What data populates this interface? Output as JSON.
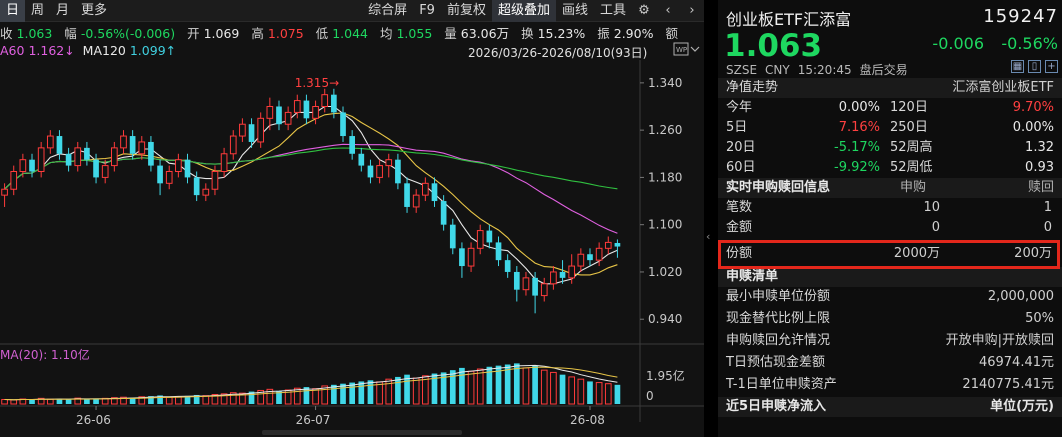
{
  "toolbar": {
    "left_tabs": [
      "日",
      "周",
      "月",
      "更多"
    ],
    "right_buttons": [
      "综合屏",
      "F9",
      "前复权",
      "超级叠加",
      "画线",
      "工具"
    ],
    "icons": [
      "gear-icon",
      "chevron-left-icon",
      "chevron-right-icon"
    ]
  },
  "info": {
    "close_label": "收",
    "close_value": "1.063",
    "change_label": "幅",
    "change_value": "-0.56%(-0.006)",
    "open_label": "开",
    "open_value": "1.069",
    "high_label": "高",
    "high_value": "1.075",
    "low_label": "低",
    "low_value": "1.044",
    "avg_label": "均",
    "avg_value": "1.055",
    "vol_label": "量",
    "vol_value": "63.06万",
    "turnover_label": "换",
    "turnover_value": "15.23%",
    "amp_label": "振",
    "amp_value": "2.90%",
    "amount_label": "额",
    "ma60_label": "A60",
    "ma60_value": "1.162↓",
    "ma120_label": "MA120",
    "ma120_value": "1.099↑",
    "date_range": "2026/03/26-2026/08/10(93日)"
  },
  "volume": {
    "label": "MA(20): 1.10亿",
    "axis_top": "1.95亿",
    "axis_zero": "0"
  },
  "chart_data": {
    "type": "candlestick",
    "y_ticks": [
      "1.340",
      "1.260",
      "1.180",
      "1.100",
      "1.020",
      "0.940"
    ],
    "ylim": [
      0.915,
      1.355
    ],
    "x_ticks": [
      "26-06",
      "26-07",
      "26-08"
    ],
    "annotation": "1.315→",
    "candles": [
      [
        1.15,
        1.16,
        1.13,
        1.17
      ],
      [
        1.16,
        1.19,
        1.15,
        1.2
      ],
      [
        1.19,
        1.21,
        1.18,
        1.22
      ],
      [
        1.21,
        1.19,
        1.18,
        1.22
      ],
      [
        1.19,
        1.23,
        1.18,
        1.24
      ],
      [
        1.23,
        1.25,
        1.22,
        1.26
      ],
      [
        1.25,
        1.22,
        1.21,
        1.26
      ],
      [
        1.22,
        1.2,
        1.19,
        1.23
      ],
      [
        1.2,
        1.23,
        1.19,
        1.24
      ],
      [
        1.23,
        1.21,
        1.2,
        1.24
      ],
      [
        1.21,
        1.18,
        1.17,
        1.22
      ],
      [
        1.18,
        1.2,
        1.17,
        1.21
      ],
      [
        1.2,
        1.23,
        1.19,
        1.24
      ],
      [
        1.23,
        1.25,
        1.22,
        1.26
      ],
      [
        1.25,
        1.22,
        1.21,
        1.26
      ],
      [
        1.22,
        1.24,
        1.21,
        1.25
      ],
      [
        1.24,
        1.2,
        1.19,
        1.25
      ],
      [
        1.2,
        1.17,
        1.15,
        1.21
      ],
      [
        1.17,
        1.19,
        1.16,
        1.2
      ],
      [
        1.19,
        1.21,
        1.18,
        1.22
      ],
      [
        1.21,
        1.18,
        1.17,
        1.22
      ],
      [
        1.18,
        1.15,
        1.14,
        1.19
      ],
      [
        1.15,
        1.16,
        1.14,
        1.17
      ],
      [
        1.16,
        1.19,
        1.15,
        1.2
      ],
      [
        1.19,
        1.22,
        1.18,
        1.23
      ],
      [
        1.22,
        1.25,
        1.21,
        1.26
      ],
      [
        1.25,
        1.27,
        1.24,
        1.28
      ],
      [
        1.27,
        1.24,
        1.23,
        1.28
      ],
      [
        1.24,
        1.28,
        1.23,
        1.29
      ],
      [
        1.28,
        1.3,
        1.26,
        1.315
      ],
      [
        1.3,
        1.27,
        1.26,
        1.31
      ],
      [
        1.27,
        1.29,
        1.26,
        1.3
      ],
      [
        1.29,
        1.31,
        1.28,
        1.32
      ],
      [
        1.31,
        1.28,
        1.27,
        1.32
      ],
      [
        1.28,
        1.3,
        1.27,
        1.31
      ],
      [
        1.3,
        1.32,
        1.29,
        1.33
      ],
      [
        1.32,
        1.29,
        1.28,
        1.33
      ],
      [
        1.29,
        1.25,
        1.24,
        1.3
      ],
      [
        1.25,
        1.22,
        1.21,
        1.26
      ],
      [
        1.22,
        1.2,
        1.19,
        1.23
      ],
      [
        1.2,
        1.18,
        1.17,
        1.21
      ],
      [
        1.18,
        1.2,
        1.17,
        1.21
      ],
      [
        1.2,
        1.21,
        1.18,
        1.22
      ],
      [
        1.21,
        1.17,
        1.16,
        1.22
      ],
      [
        1.17,
        1.13,
        1.12,
        1.18
      ],
      [
        1.13,
        1.15,
        1.12,
        1.16
      ],
      [
        1.15,
        1.17,
        1.14,
        1.18
      ],
      [
        1.17,
        1.14,
        1.13,
        1.18
      ],
      [
        1.14,
        1.1,
        1.09,
        1.15
      ],
      [
        1.1,
        1.06,
        1.05,
        1.11
      ],
      [
        1.06,
        1.03,
        1.01,
        1.07
      ],
      [
        1.03,
        1.06,
        1.02,
        1.07
      ],
      [
        1.06,
        1.09,
        1.05,
        1.1
      ],
      [
        1.09,
        1.07,
        1.06,
        1.1
      ],
      [
        1.07,
        1.04,
        1.03,
        1.08
      ],
      [
        1.04,
        1.02,
        1.01,
        1.05
      ],
      [
        1.02,
        0.99,
        0.97,
        1.03
      ],
      [
        0.99,
        1.01,
        0.98,
        1.02
      ],
      [
        1.01,
        0.98,
        0.95,
        1.02
      ],
      [
        0.98,
        1.0,
        0.97,
        1.01
      ],
      [
        1.0,
        1.02,
        0.99,
        1.03
      ],
      [
        1.02,
        1.01,
        1.0,
        1.04
      ],
      [
        1.01,
        1.03,
        1.0,
        1.05
      ],
      [
        1.03,
        1.05,
        1.02,
        1.06
      ],
      [
        1.05,
        1.04,
        1.03,
        1.06
      ],
      [
        1.04,
        1.06,
        1.03,
        1.07
      ],
      [
        1.06,
        1.07,
        1.05,
        1.08
      ],
      [
        1.069,
        1.063,
        1.044,
        1.075
      ]
    ],
    "volumes": [
      0.2,
      0.18,
      0.22,
      0.19,
      0.25,
      0.21,
      0.23,
      0.2,
      0.26,
      0.24,
      0.22,
      0.25,
      0.28,
      0.3,
      0.27,
      0.32,
      0.35,
      0.38,
      0.3,
      0.33,
      0.36,
      0.4,
      0.37,
      0.42,
      0.45,
      0.5,
      0.48,
      0.55,
      0.6,
      0.65,
      0.58,
      0.62,
      0.7,
      0.75,
      0.68,
      0.8,
      0.85,
      0.9,
      0.95,
      1.0,
      1.05,
      0.98,
      1.1,
      1.2,
      1.3,
      1.15,
      1.25,
      1.35,
      1.4,
      1.5,
      1.6,
      1.45,
      1.55,
      1.65,
      1.7,
      1.75,
      1.8,
      1.6,
      1.7,
      1.5,
      1.4,
      1.3,
      1.2,
      1.1,
      1.0,
      0.95,
      0.9,
      0.85
    ],
    "series": [
      {
        "name": "MA5",
        "color": "#e8e8e8"
      },
      {
        "name": "MA10",
        "color": "#e8c547"
      },
      {
        "name": "MA60",
        "color": "#e060e0"
      },
      {
        "name": "MA120",
        "color": "#30c040"
      }
    ],
    "bull_color": "#ff3b3b",
    "bear_color": "#40d8e8"
  },
  "fund": {
    "name": "创业板ETF汇添富",
    "code": "159247",
    "price": "1.063",
    "change": "-0.006",
    "pct": "-0.56%",
    "exchange": "SZSE",
    "currency": "CNY",
    "time": "15:20:45",
    "status": "盘后交易"
  },
  "nav": {
    "title": "净值走势",
    "title_right": "汇添富创业板ETF",
    "rows": [
      {
        "l1": "今年",
        "v1": "0.00%",
        "c1": "white",
        "l2": "120日",
        "v2": "9.70%",
        "c2": "red"
      },
      {
        "l1": "5日",
        "v1": "7.16%",
        "c1": "red",
        "l2": "250日",
        "v2": "0.00%",
        "c2": "white"
      },
      {
        "l1": "20日",
        "v1": "-5.17%",
        "c1": "green",
        "l2": "52周高",
        "v2": "1.32",
        "c2": "white"
      },
      {
        "l1": "60日",
        "v1": "-9.92%",
        "c1": "green",
        "l2": "52周低",
        "v2": "0.93",
        "c2": "white"
      }
    ]
  },
  "subscription": {
    "title": "实时申购赎回信息",
    "col_buy": "申购",
    "col_sell": "赎回",
    "rows": [
      {
        "label": "笔数",
        "buy": "10",
        "sell": "1"
      },
      {
        "label": "金额",
        "buy": "0",
        "sell": "0"
      },
      {
        "label": "份额",
        "buy": "2000万",
        "sell": "200万"
      }
    ]
  },
  "redemption_list": {
    "title": "申赎清单",
    "rows": [
      {
        "label": "最小申赎单位份额",
        "value": "2,000,000"
      },
      {
        "label": "现金替代比例上限",
        "value": "50%"
      },
      {
        "label": "申购赎回允许情况",
        "value": "开放申购|开放赎回"
      },
      {
        "label": "T日预估现金差额",
        "value": "46974.41元"
      },
      {
        "label": "T-1日单位申赎资产",
        "value": "2140775.41元"
      }
    ]
  },
  "net_inflow": {
    "title": "近5日申赎净流入",
    "unit": "单位(万元)"
  }
}
